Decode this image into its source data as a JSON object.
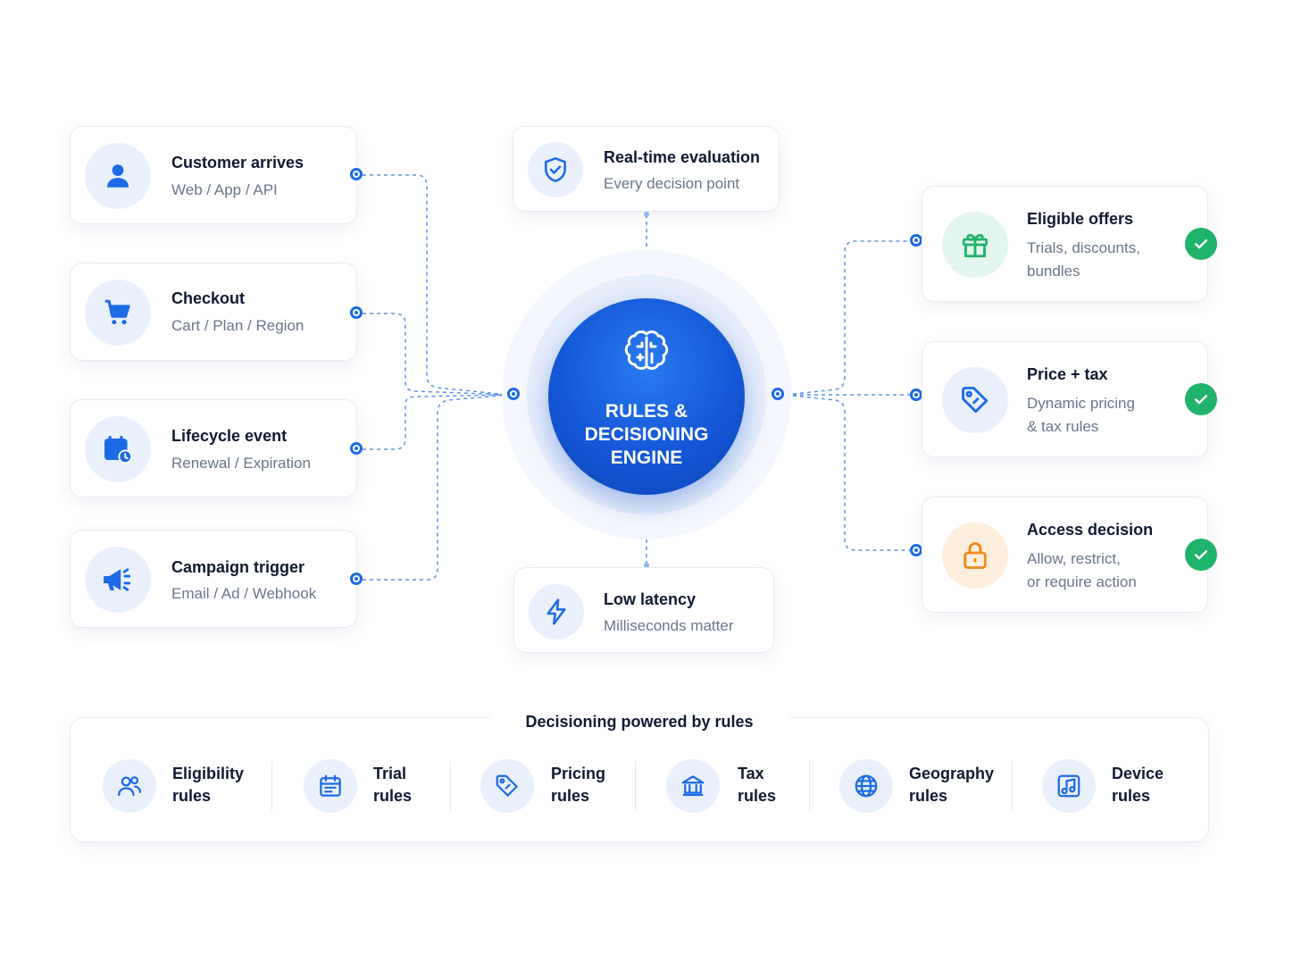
{
  "inputs": [
    {
      "title": "Customer arrives",
      "sub": "Web / App / API",
      "icon": "user-icon"
    },
    {
      "title": "Checkout",
      "sub": "Cart / Plan / Region",
      "icon": "cart-icon"
    },
    {
      "title": "Lifecycle event",
      "sub": "Renewal / Expiration",
      "icon": "calendar-clock-icon"
    },
    {
      "title": "Campaign trigger",
      "sub": "Email / Ad / Webhook",
      "icon": "megaphone-icon"
    }
  ],
  "top_node": {
    "title": "Real-time evaluation",
    "sub": "Every decision point",
    "icon": "shield-check-icon"
  },
  "bottom_node": {
    "title": "Low latency",
    "sub": "Milliseconds matter",
    "icon": "lightning-icon"
  },
  "engine": {
    "line1": "RULES &",
    "line2": "DECISIONING",
    "line3": "ENGINE",
    "icon": "brain-icon"
  },
  "outputs": [
    {
      "title": "Eligible offers",
      "sub1": "Trials, discounts,",
      "sub2": "bundles",
      "icon": "gift-icon",
      "status": "check-icon"
    },
    {
      "title": "Price + tax",
      "sub1": "Dynamic pricing",
      "sub2": "& tax rules",
      "icon": "tag-icon",
      "status": "check-icon"
    },
    {
      "title": "Access decision",
      "sub1": "Allow, restrict,",
      "sub2": "or require action",
      "icon": "lock-icon",
      "status": "check-icon"
    }
  ],
  "rules_panel": {
    "title": "Decisioning powered by rules",
    "items": [
      {
        "line1": "Eligibility",
        "line2": "rules",
        "icon": "users-icon"
      },
      {
        "line1": "Trial",
        "line2": "rules",
        "icon": "calendar-icon"
      },
      {
        "line1": "Pricing",
        "line2": "rules",
        "icon": "price-tag-icon"
      },
      {
        "line1": "Tax",
        "line2": "rules",
        "icon": "bank-icon"
      },
      {
        "line1": "Geography",
        "line2": "rules",
        "icon": "globe-icon"
      },
      {
        "line1": "Device",
        "line2": "rules",
        "icon": "music-device-icon"
      }
    ]
  },
  "colors": {
    "accent": "#1d6ae5",
    "success": "#1fb36b",
    "offer": "#1fb36b",
    "access": "#f08a1c"
  }
}
